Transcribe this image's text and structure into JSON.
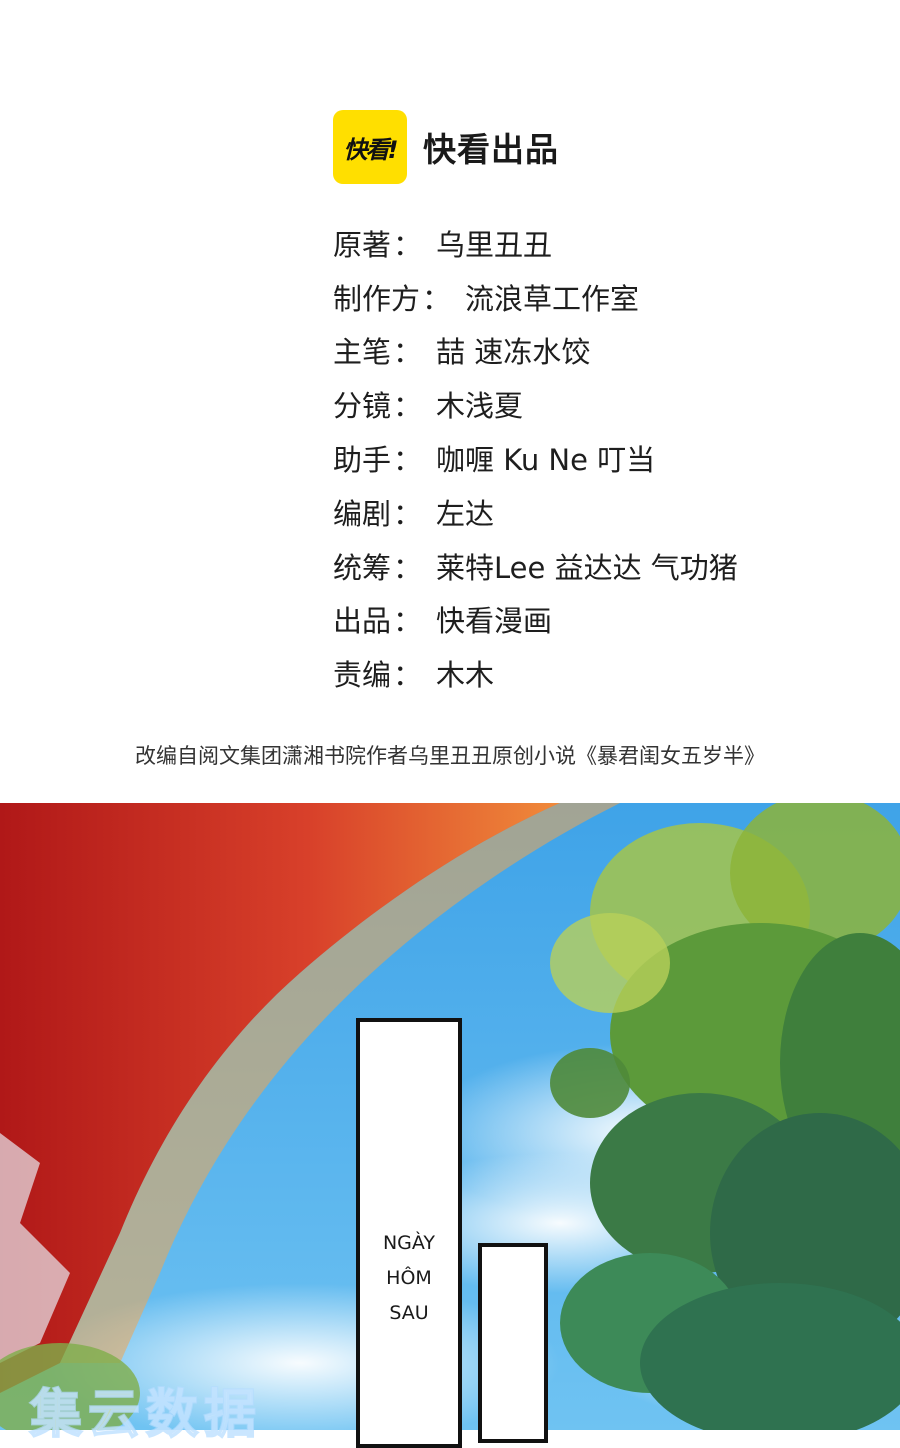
{
  "brand": {
    "logo_text": "快看!",
    "title": "快看出品",
    "logo_color": "#ffdf00"
  },
  "credits": [
    {
      "role": "原著",
      "value": "乌里丑丑"
    },
    {
      "role": "制作方",
      "value": "流浪草工作室"
    },
    {
      "role": "主笔",
      "value": "喆 速冻水饺"
    },
    {
      "role": "分镜",
      "value": "木浅夏"
    },
    {
      "role": "助手",
      "value": "咖喱 Ku Ne 叮当"
    },
    {
      "role": "编剧",
      "value": "左达"
    },
    {
      "role": "统筹",
      "value": "莱特Lee  益达达 气功猪"
    },
    {
      "role": "出品",
      "value": "快看漫画"
    },
    {
      "role": "责编",
      "value": "木木"
    }
  ],
  "separator": "：",
  "adaptation_note": "改编自阅文集团潇湘书院作者乌里丑丑原创小说《暴君闺女五岁半》",
  "panel": {
    "caption_lines": [
      "NGÀY",
      "HÔM",
      "SAU"
    ],
    "watermark": "集云数据"
  }
}
